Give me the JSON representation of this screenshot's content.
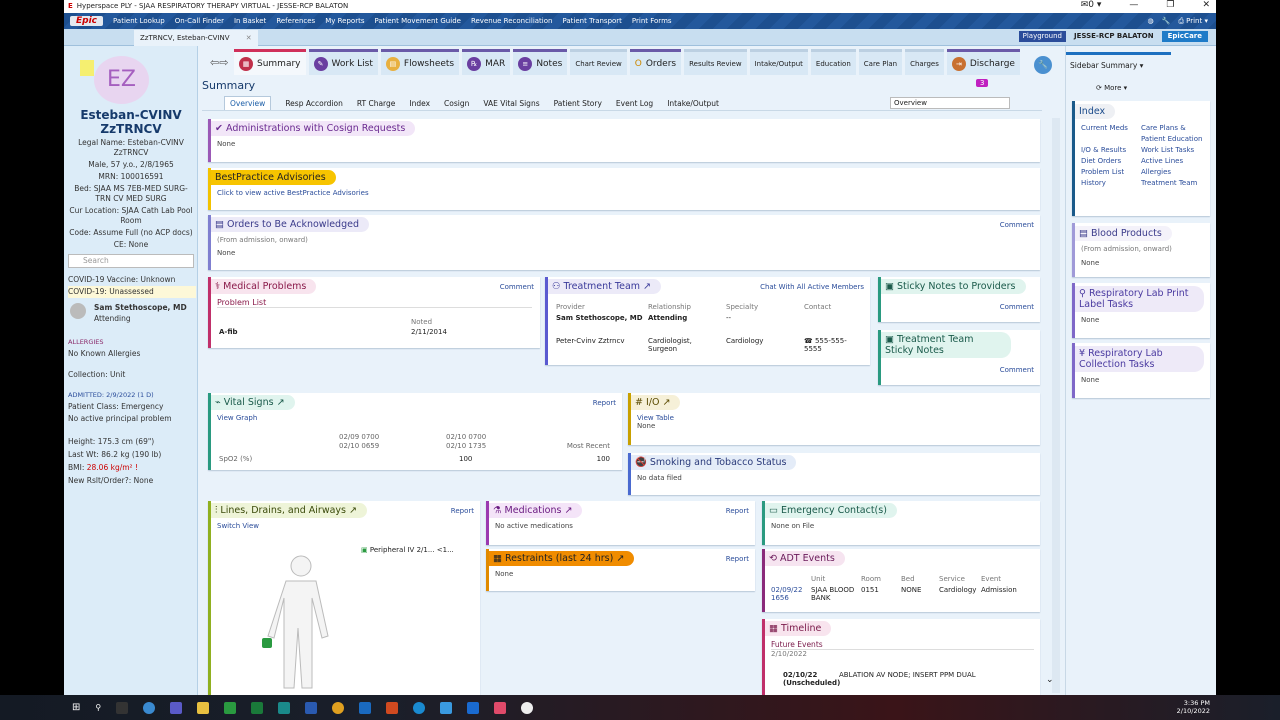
{
  "window": {
    "title": "Hyperspace PLY - SJAA RESPIRATORY THERAPY VIRTUAL - JESSE-RCP BALATON",
    "msg_count": "0"
  },
  "toolbar": {
    "epic": "Epic",
    "items": [
      "Patient Lookup",
      "On-Call Finder",
      "In Basket",
      "References",
      "My Reports",
      "Patient Movement Guide",
      "Revenue Reconciliation",
      "Patient Transport",
      "Print Forms"
    ],
    "print": "Print"
  },
  "patient_tab": "ZzTRNCV, Esteban-CVINV",
  "env": {
    "mode": "Playground",
    "user": "JESSE-RCP BALATON",
    "app": "EpicCare"
  },
  "patient": {
    "initials": "EZ",
    "name": "Esteban-CVINV ZzTRNCV",
    "legal": "Legal Name: Esteban-CVINV ZzTRNCV",
    "demo": "Male, 57 y.o., 2/8/1965",
    "mrn": "MRN: 100016591",
    "bed": "Bed: SJAA MS 7EB-MED SURG-TRN CV MED SURG",
    "location": "Cur Location: SJAA Cath Lab Pool Room",
    "code": "Code: Assume Full (no ACP docs)",
    "ce": "CE: None",
    "search_placeholder": "Search",
    "covid_vaccine": "COVID-19 Vaccine: Unknown",
    "covid": "COVID-19: Unassessed",
    "attending_name": "Sam Stethoscope, MD",
    "attending_role": "Attending",
    "allergies_label": "ALLERGIES",
    "allergies": "No Known Allergies",
    "collection": "Collection: Unit",
    "admitted": "ADMITTED: 2/9/2022 (1 D)",
    "pt_class": "Patient Class: Emergency",
    "principal": "No active principal problem",
    "height": "Height:  175.3 cm (69\")",
    "weight": "Last Wt:  86.2 kg (190 lb)",
    "bmi_label": "BMI:",
    "bmi": "28.06 kg/m² !",
    "new_rslt": "New Rslt/Order?: None"
  },
  "activity_tabs": [
    {
      "label": "Summary",
      "selected": true
    },
    {
      "label": "Work List"
    },
    {
      "label": "Flowsheets"
    },
    {
      "label": "MAR"
    },
    {
      "label": "Notes"
    },
    {
      "label": "Chart Review",
      "small": true
    },
    {
      "label": "Orders"
    },
    {
      "label": "Results Review",
      "small": true
    },
    {
      "label": "Intake/Output",
      "small": true
    },
    {
      "label": "Education",
      "small": true
    },
    {
      "label": "Care Plan",
      "small": true
    },
    {
      "label": "Charges",
      "small": true
    },
    {
      "label": "Discharge"
    }
  ],
  "summary": {
    "title": "Summary",
    "badge": "3",
    "search_value": "Overview",
    "subtabs": [
      "Overview",
      "Resp Accordion",
      "RT Charge",
      "Index",
      "Cosign",
      "VAE Vital Signs",
      "Patient Story",
      "Event Log",
      "Intake/Output"
    ]
  },
  "sections": {
    "cosign": {
      "title": "Administrations with Cosign Requests",
      "body": "None"
    },
    "bpa": {
      "title": "BestPractice Advisories",
      "link": "Click to view active BestPractice Advisories"
    },
    "orders_ack": {
      "title": "Orders to Be Acknowledged",
      "note": "(From admission, onward)",
      "body": "None",
      "action": "Comment"
    },
    "medical_problems": {
      "title": "Medical Problems",
      "action": "Comment",
      "subhead": "Problem List",
      "col_noted": "Noted",
      "problem": "A-fib",
      "noted": "2/11/2014"
    },
    "treatment_team": {
      "title": "Treatment Team",
      "action": "Chat With All Active Members",
      "headers": [
        "Provider",
        "Relationship",
        "Specialty",
        "Contact"
      ],
      "rows": [
        [
          "Sam Stethoscope, MD",
          "Attending",
          "--",
          ""
        ],
        [
          "Peter-Cvinv Zztrncv",
          "Cardiologist, Surgeon",
          "Cardiology",
          "555-555-5555"
        ]
      ]
    },
    "sticky_providers": {
      "title": "Sticky Notes to Providers",
      "action": "Comment"
    },
    "sticky_team": {
      "title": "Treatment Team Sticky Notes",
      "action": "Comment"
    },
    "vitals": {
      "title": "Vital Signs",
      "action": "Report",
      "link": "View Graph",
      "col1a": "02/09 0700",
      "col1b": "02/10 0659",
      "col2a": "02/10 0700",
      "col2b": "02/10 1735",
      "col3": "Most Recent",
      "row_label": "SpO2 (%)",
      "v2": "100",
      "v3": "100"
    },
    "io": {
      "title": "I/O",
      "link": "View Table",
      "body": "None"
    },
    "smoking": {
      "title": "Smoking and Tobacco Status",
      "body": "No data filed"
    },
    "lines": {
      "title": "Lines, Drains, and Airways",
      "action": "Report",
      "link": "Switch View",
      "device": "Peripheral IV 2/1...",
      "device_age": "<1..."
    },
    "medications": {
      "title": "Medications",
      "action": "Report",
      "body": "No active medications"
    },
    "restraints": {
      "title": "Restraints (last 24 hrs)",
      "action": "Report",
      "body": "None"
    },
    "emergency": {
      "title": "Emergency Contact(s)",
      "body": "None on File"
    },
    "adt": {
      "title": "ADT Events",
      "headers": [
        "Unit",
        "Room",
        "Bed",
        "Service",
        "Event"
      ],
      "date": "02/09/22 1656",
      "unit": "SJAA BLOOD BANK",
      "room": "0151",
      "bed": "NONE",
      "service": "Cardiology",
      "event": "Admission"
    },
    "timeline": {
      "title": "Timeline",
      "subhead": "Future Events",
      "date": "2/10/2022",
      "ev_date": "02/10/22 (Unscheduled)",
      "ev_desc": "ABLATION AV NODE; INSERT PPM DUAL"
    }
  },
  "sidebar": {
    "title": "Sidebar Summary",
    "more": "More",
    "index_title": "Index",
    "index_links": [
      "Current Meds",
      "Care Plans & Patient Education",
      "I/O & Results",
      "Work List Tasks",
      "Diet Orders",
      "Active Lines",
      "Problem List",
      "Allergies",
      "History",
      "Treatment Team"
    ],
    "blood": {
      "title": "Blood Products",
      "note": "(From admission, onward)",
      "body": "None"
    },
    "print_label": {
      "title": "Respiratory Lab Print Label Tasks",
      "body": "None"
    },
    "collection": {
      "title": "Respiratory Lab Collection Tasks",
      "body": "None"
    }
  },
  "taskbar": {
    "time": "3:36 PM",
    "date": "2/10/2022"
  }
}
